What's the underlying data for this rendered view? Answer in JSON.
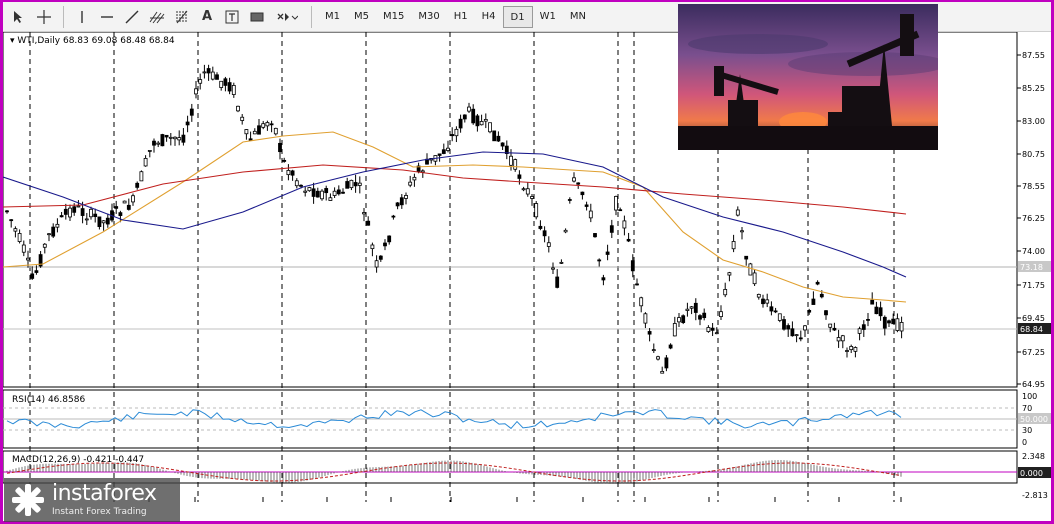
{
  "toolbar": {
    "tools": [
      "cursor-icon",
      "crosshair-icon",
      "vertical-line-icon",
      "horizontal-line-icon",
      "trendline-icon",
      "andrews-pitchfork-icon",
      "fibonacci-icon",
      "text-icon",
      "text-label-icon",
      "rectangle-icon",
      "shapes-dropdown-icon"
    ],
    "timeframes": [
      "M1",
      "M5",
      "M15",
      "M30",
      "H1",
      "H4",
      "D1",
      "W1",
      "MN"
    ],
    "active_timeframe": "D1"
  },
  "symbol": {
    "name": "WTI,Daily",
    "ohlc": "68.83 69.08 68.48 68.84"
  },
  "price_axis": {
    "ticks": [
      "87.55",
      "85.25",
      "83.00",
      "80.75",
      "78.55",
      "76.25",
      "74.00",
      "71.75",
      "69.45",
      "67.25",
      "64.95"
    ],
    "current_price": "68.84",
    "level_price": "73.18"
  },
  "time_axis": {
    "labels": [
      "Mar 2024",
      "3 Apr 2024",
      "25 Apr 2024",
      "17 May 2024",
      "10 Jun 2024",
      "2 Jul 2024",
      "24 Jul 2024",
      "15 Aug 2024",
      "6 Sep 2024",
      "30 Sep 2024",
      "22 Oct 2024",
      "13 Nov 2024",
      "5 Dec 2024"
    ]
  },
  "rsi": {
    "label": "RSI(14) 46.8586",
    "ticks": [
      "100",
      "70",
      "30",
      "0"
    ],
    "level_badge": "50.000"
  },
  "macd": {
    "label": "MACD(12,26,9) -0.421 -0.447",
    "ticks": [
      "2.348",
      "-2.813"
    ],
    "level_badge": "0.000"
  },
  "logo": {
    "brand": "instaforex",
    "tagline": "Instant Forex Trading"
  },
  "colors": {
    "ma_fast": "#e0a030",
    "ma_mid": "#c0201e",
    "ma_slow": "#1a1a8c",
    "rsi_line": "#2a8ad6",
    "macd_signal": "#c0201e",
    "accent_frame": "#c000c0",
    "badge_bg": "#202020"
  }
}
